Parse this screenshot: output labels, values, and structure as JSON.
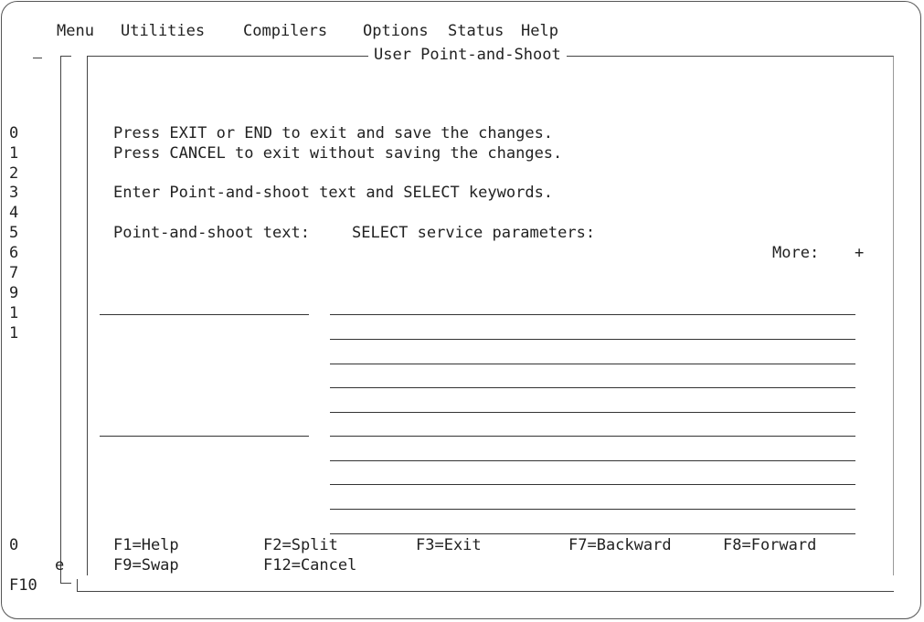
{
  "menubar": {
    "items": [
      "Menu",
      "Utilities",
      "Compilers",
      "Options",
      "Status",
      "Help"
    ]
  },
  "popup": {
    "title": "User Point-and-Shoot",
    "instructions": [
      "Press EXIT or END to exit and save the changes.",
      "Press CANCEL to exit without saving the changes."
    ],
    "enter_text": "Enter Point-and-shoot text and SELECT keywords.",
    "col_pas_label": "Point-and-shoot text:",
    "col_select_label": "SELECT service parameters:",
    "more_label": "More:",
    "more_indicator": "+",
    "pas_fields": [
      "",
      ""
    ],
    "select_fields": [
      "",
      "",
      "",
      "",
      "",
      "",
      "",
      "",
      "",
      ""
    ]
  },
  "function_keys": {
    "row1": [
      "F1=Help",
      "F2=Split",
      "F3=Exit",
      "F7=Backward",
      "F8=Forward"
    ],
    "row2": [
      "F9=Swap",
      "F12=Cancel"
    ]
  },
  "background": {
    "line_numbers": [
      "0",
      "1",
      "2",
      "3",
      "4",
      "5",
      "6",
      "7",
      "9",
      "1",
      "1"
    ],
    "bottom_zero": "0",
    "bottom_e": "e",
    "bottom_f10": "F10"
  }
}
